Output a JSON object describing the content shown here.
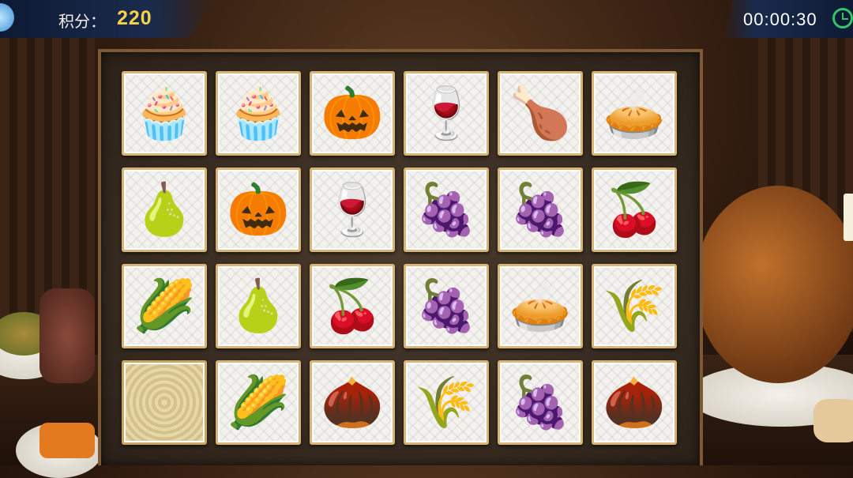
{
  "hud": {
    "score_label": "积分：",
    "score_value": "220",
    "timer": "00:00:30",
    "timer_icon": "clock-icon"
  },
  "board": {
    "rows": 4,
    "cols": 6,
    "tiles": [
      {
        "item": "cupcake",
        "glyph": "🧁",
        "color": "#5a2a18"
      },
      {
        "item": "cupcake",
        "glyph": "🧁",
        "color": "#5a2a18"
      },
      {
        "item": "pumpkin",
        "glyph": "🎃",
        "color": "#e8701a"
      },
      {
        "item": "wine-glass",
        "glyph": "🍷",
        "color": "#7a1020"
      },
      {
        "item": "roast-turkey",
        "glyph": "🍗",
        "color": "#9b4a1c"
      },
      {
        "item": "pie",
        "glyph": "🥧",
        "color": "#c2772f"
      },
      {
        "item": "pear",
        "glyph": "🍐",
        "color": "#d9c35a"
      },
      {
        "item": "pumpkin",
        "glyph": "🎃",
        "color": "#e8701a"
      },
      {
        "item": "wine-glass",
        "glyph": "🍷",
        "color": "#7a1020"
      },
      {
        "item": "purple-grapes",
        "glyph": "🍇",
        "color": "#7c2fae"
      },
      {
        "item": "purple-grapes",
        "glyph": "🍇",
        "color": "#7c2fae"
      },
      {
        "item": "cherries",
        "glyph": "🍒",
        "color": "#c1121f"
      },
      {
        "item": "corn",
        "glyph": "🌽",
        "color": "#d9a12b"
      },
      {
        "item": "pear",
        "glyph": "🍐",
        "color": "#d9c35a"
      },
      {
        "item": "cherries",
        "glyph": "🍒",
        "color": "#c1121f"
      },
      {
        "item": "green-grapes",
        "glyph": "🍇",
        "color": "#7fa334"
      },
      {
        "item": "pie",
        "glyph": "🥧",
        "color": "#c2772f"
      },
      {
        "item": "wheat",
        "glyph": "🌾",
        "color": "#a07a3c"
      },
      {
        "item": "empty",
        "glyph": "",
        "color": "#e7d7a8"
      },
      {
        "item": "corn",
        "glyph": "🌽",
        "color": "#d9a12b"
      },
      {
        "item": "acorn",
        "glyph": "🌰",
        "color": "#6b4521"
      },
      {
        "item": "wheat",
        "glyph": "🌾",
        "color": "#a07a3c"
      },
      {
        "item": "green-grapes",
        "glyph": "🍇",
        "color": "#7fa334"
      },
      {
        "item": "acorn",
        "glyph": "🌰",
        "color": "#6b4521"
      }
    ]
  }
}
